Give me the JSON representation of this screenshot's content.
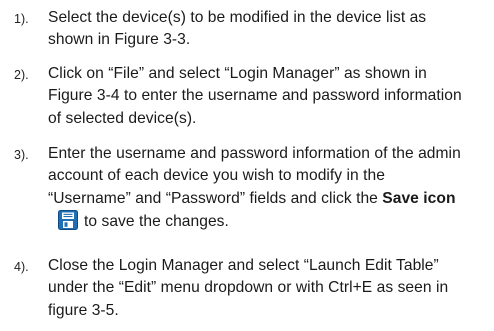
{
  "steps": [
    {
      "number": "1).",
      "lines": [
        "Select the device(s) to be modified in the device list as",
        "shown in Figure 3-3."
      ]
    },
    {
      "number": "2).",
      "lines": [
        "Click on “File” and select “Login Manager” as shown in",
        "Figure 3-4 to enter the username and password information",
        "of selected device(s)."
      ]
    },
    {
      "number": "3).",
      "lines": [
        "Enter the username and password information of the admin",
        "account of each device you wish to modify in the"
      ],
      "line3_prefix": "“Username” and “Password” fields and click the ",
      "line3_bold": "Save icon",
      "line4_text": "to save the changes."
    },
    {
      "number": "4).",
      "lines": [
        "Close the Login Manager and select “Launch Edit Table”",
        "under the “Edit” menu dropdown or with Ctrl+E as seen in",
        "figure 3-5."
      ]
    }
  ],
  "icons": {
    "save": "floppy-disk-save-icon",
    "save_color": "#1f6fb5"
  }
}
